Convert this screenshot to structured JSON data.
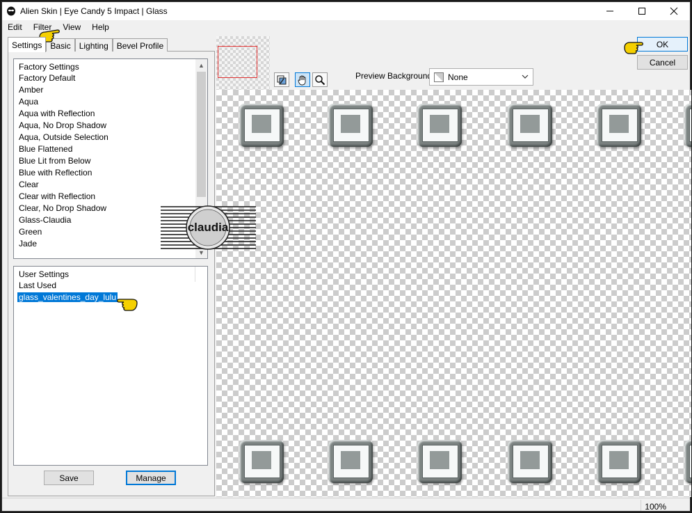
{
  "window": {
    "title": "Alien Skin | Eye Candy 5 Impact | Glass"
  },
  "menu": {
    "items": [
      "Edit",
      "Filter",
      "View",
      "Help"
    ]
  },
  "tabs": [
    "Settings",
    "Basic",
    "Lighting",
    "Bevel Profile"
  ],
  "factory_settings": {
    "header": "Factory Settings",
    "items": [
      "Factory Default",
      "Amber",
      "Aqua",
      "Aqua with Reflection",
      "Aqua, No Drop Shadow",
      "Aqua, Outside Selection",
      "Blue Flattened",
      "Blue Lit from Below",
      "Blue with Reflection",
      "Clear",
      "Clear with Reflection",
      "Clear, No Drop Shadow",
      "Glass-Claudia",
      "Green",
      "Jade"
    ]
  },
  "user_settings": {
    "header": "User Settings",
    "items": [
      "Last Used",
      "glass_valentines_day_lulu"
    ],
    "selected_index": 1
  },
  "buttons": {
    "save": "Save",
    "manage": "Manage",
    "ok": "OK",
    "cancel": "Cancel"
  },
  "preview_background": {
    "label": "Preview Background:",
    "value": "None"
  },
  "status": {
    "zoom": "100%"
  },
  "watermark": {
    "text": "claudia"
  },
  "colors": {
    "accent": "#0078d7",
    "pointer": "#f5d000",
    "nav_box": "#e03030"
  }
}
